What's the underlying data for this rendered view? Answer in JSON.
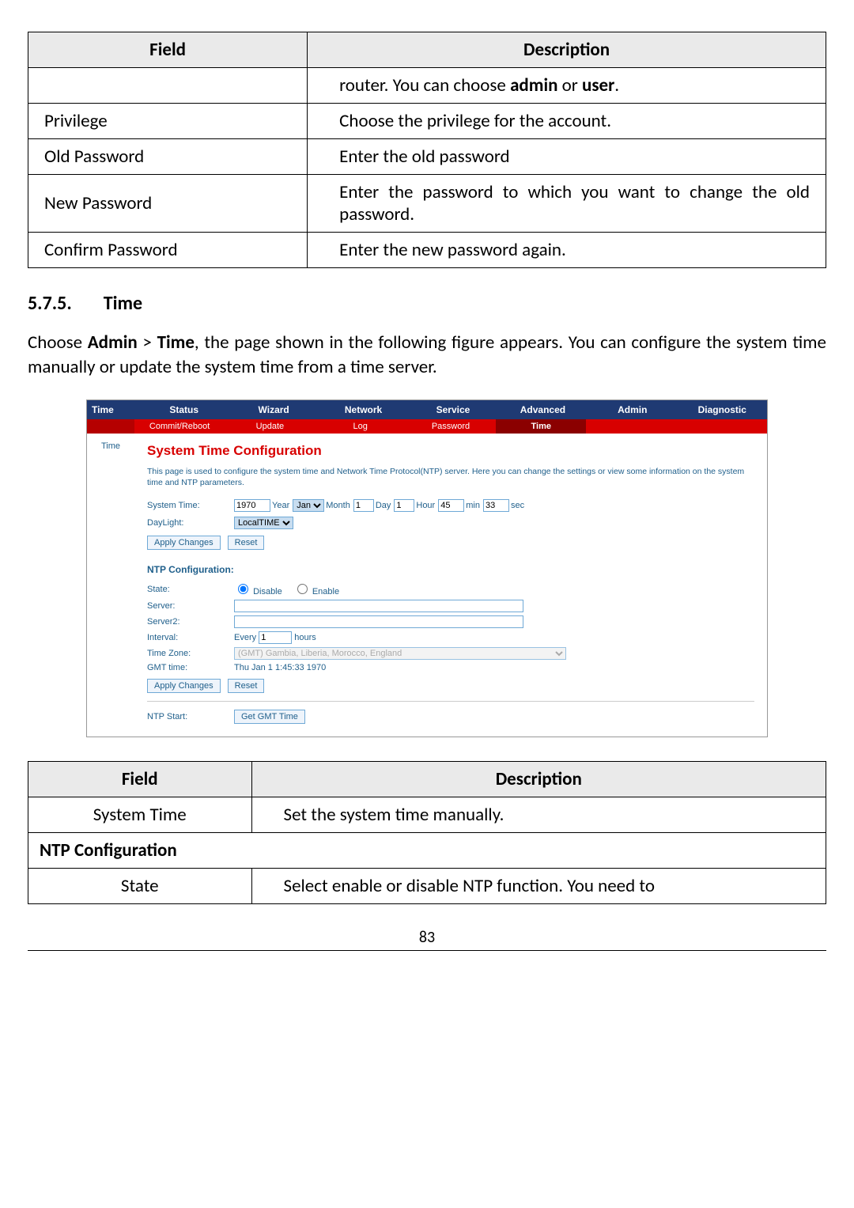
{
  "table1": {
    "headers": {
      "field": "Field",
      "desc": "Description"
    },
    "rows": [
      {
        "field": "",
        "desc_prefix": "router. You can choose ",
        "bold1": "admin",
        "mid": " or ",
        "bold2": "user",
        "suffix": "."
      },
      {
        "field": "Privilege",
        "desc": "Choose the privilege for the account."
      },
      {
        "field": "Old Password",
        "desc": "Enter the old password"
      },
      {
        "field": "New Password",
        "desc": "Enter the password to which you want to change the old password."
      },
      {
        "field": "Confirm Password",
        "desc": "Enter the new password again."
      }
    ]
  },
  "section": {
    "number": "5.7.5.",
    "title": "Time",
    "para_prefix": "Choose ",
    "b1": "Admin",
    "gt": " > ",
    "b2": "Time",
    "para_rest": ", the page shown in the following figure appears. You can configure the system time manually or update the system time from a time server."
  },
  "router": {
    "maintabs": {
      "left": "Time",
      "items": [
        "Status",
        "Wizard",
        "Network",
        "Service",
        "Advanced",
        "Admin",
        "Diagnostic"
      ],
      "activeIndex": 5
    },
    "subtabs": {
      "items": [
        "Commit/Reboot",
        "Update",
        "Log",
        "Password",
        "Time"
      ],
      "activeIndex": 4
    },
    "sidebar": "Time",
    "heading": "System Time Configuration",
    "hint": "This page is used to configure the system time and Network Time Protocol(NTP) server. Here you can change the settings or view some information on the system time and NTP parameters.",
    "systime": {
      "label": "System Time:",
      "year": "1970",
      "year_lbl": "Year",
      "month": "Jan",
      "month_lbl": "Month",
      "month_val": "1",
      "day_lbl": "Day",
      "day": "1",
      "hour_lbl": "Hour",
      "hour": "45",
      "min_lbl": "min",
      "min": "33",
      "sec_lbl": "sec"
    },
    "daylight": {
      "label": "DayLight:",
      "value": "LocalTIME"
    },
    "buttons": {
      "apply": "Apply Changes",
      "reset": "Reset",
      "getgmt": "Get GMT Time"
    },
    "ntp": {
      "section": "NTP Configuration:",
      "state_lbl": "State:",
      "disable": "Disable",
      "enable": "Enable",
      "server_lbl": "Server:",
      "server2_lbl": "Server2:",
      "interval_lbl": "Interval:",
      "interval_prefix": "Every",
      "interval_val": "1",
      "interval_unit": "hours",
      "timezone_lbl": "Time Zone:",
      "timezone": "(GMT) Gambia, Liberia, Morocco, England",
      "gmttime_lbl": "GMT time:",
      "gmttime": "Thu Jan 1 1:45:33 1970",
      "ntpstart_lbl": "NTP Start:"
    }
  },
  "table2": {
    "headers": {
      "field": "Field",
      "desc": "Description"
    },
    "rows": [
      {
        "field": "System Time",
        "desc": "Set the system time manually."
      },
      {
        "section": "NTP Configuration"
      },
      {
        "field": "State",
        "desc": "Select enable or disable NTP function. You need to"
      }
    ]
  },
  "page_num": "83"
}
